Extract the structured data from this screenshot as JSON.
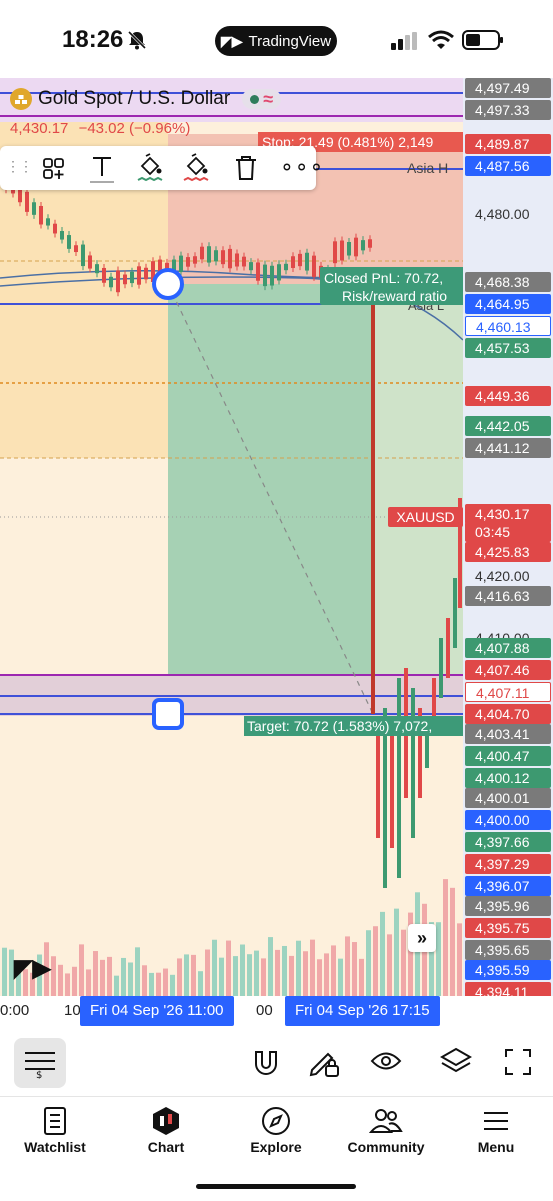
{
  "status_bar": {
    "time": "18:26",
    "app_pill": "TradingView"
  },
  "symbol": {
    "title": "Gold Spot / U.S. Dollar",
    "price": "4,430.17",
    "change": "−43.02 (−0.96%)"
  },
  "drawings": {
    "stop_label": "Stop: 21.49 (0.481%) 2,149",
    "asia_high_label": "Asia H",
    "asia_low_label": "Asia L",
    "pnl_label": "Closed PnL: 70.72,",
    "rr_label": "Risk/reward ratio",
    "target_label": "Target: 70.72 (1.583%) 7,072,",
    "symbol_label": "XAUUSD"
  },
  "price_axis": {
    "labels": [
      {
        "text": "4,497.49",
        "style": "gray"
      },
      {
        "text": "4,497.33",
        "style": "gray"
      },
      {
        "text": "4,489.87",
        "style": "red"
      },
      {
        "text": "4,487.56",
        "style": "blue"
      },
      {
        "text": "4,480.00",
        "style": "plain"
      },
      {
        "text": "4,468.38",
        "style": "gray"
      },
      {
        "text": "4,464.95",
        "style": "blue"
      },
      {
        "text": "4,460.13",
        "style": "outline"
      },
      {
        "text": "4,457.53",
        "style": "green"
      },
      {
        "text": "4,449.36",
        "style": "red"
      },
      {
        "text": "4,442.05",
        "style": "green"
      },
      {
        "text": "4,441.12",
        "style": "gray"
      },
      {
        "text": "4,430.17",
        "style": "red"
      },
      {
        "text": "03:45",
        "style": "red"
      },
      {
        "text": "4,425.83",
        "style": "red"
      },
      {
        "text": "4,420.00",
        "style": "plain"
      },
      {
        "text": "4,416.63",
        "style": "gray"
      },
      {
        "text": "4,410.00",
        "style": "plain"
      },
      {
        "text": "4,407.88",
        "style": "green"
      },
      {
        "text": "4,407.46",
        "style": "red"
      },
      {
        "text": "4,407.11",
        "style": "outline-red"
      },
      {
        "text": "4,404.70",
        "style": "red"
      },
      {
        "text": "4,403.41",
        "style": "gray"
      },
      {
        "text": "4,400.47",
        "style": "green"
      },
      {
        "text": "4,400.12",
        "style": "green"
      },
      {
        "text": "4,400.01",
        "style": "gray"
      },
      {
        "text": "4,400.00",
        "style": "blue"
      },
      {
        "text": "4,397.66",
        "style": "green"
      },
      {
        "text": "4,397.29",
        "style": "red"
      },
      {
        "text": "4,396.07",
        "style": "blue"
      },
      {
        "text": "4,395.96",
        "style": "gray"
      },
      {
        "text": "4,395.75",
        "style": "red"
      },
      {
        "text": "4,395.65",
        "style": "gray"
      },
      {
        "text": "4,395.59",
        "style": "blue"
      },
      {
        "text": "4,394.11",
        "style": "red"
      }
    ]
  },
  "time_axis": {
    "left_partial": "0:00",
    "mid_partial_a": "10",
    "mid_partial_b": "00",
    "start_label": "Fri 04 Sep '26   11:00",
    "end_label": "Fri 04 Sep '26   17:15"
  },
  "nav": {
    "items": [
      {
        "label": "Watchlist",
        "icon": "book-icon"
      },
      {
        "label": "Chart",
        "icon": "candlestick-icon"
      },
      {
        "label": "Explore",
        "icon": "compass-icon"
      },
      {
        "label": "Community",
        "icon": "people-icon"
      },
      {
        "label": "Menu",
        "icon": "hamburger-icon"
      }
    ]
  },
  "colors": {
    "red": "#e04848",
    "green": "#3d9970",
    "blue": "#2962ff",
    "purple": "#9c27b0",
    "zone_orange": "#fdf0dc",
    "profit_green": "#a6d1b4",
    "loss_red": "#f3c2b3"
  }
}
